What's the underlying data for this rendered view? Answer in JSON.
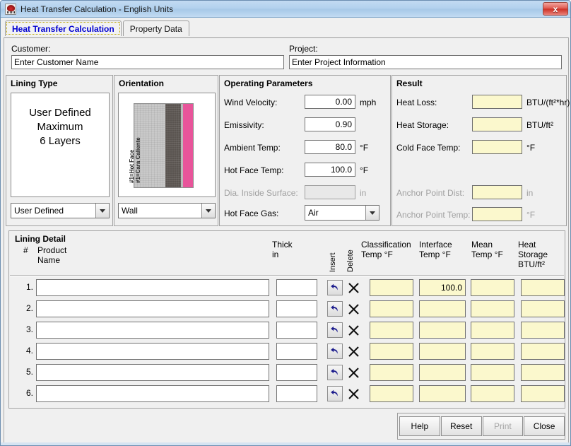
{
  "window": {
    "title": "Heat Transfer Calculation - English Units",
    "app_icon": "app-logo-icon",
    "close_label": "x"
  },
  "tabs": [
    {
      "label": "Heat Transfer Calculation",
      "active": true
    },
    {
      "label": "Property Data",
      "active": false
    }
  ],
  "header_fields": {
    "customer_label": "Customer:",
    "customer_value": "Enter Customer Name",
    "project_label": "Project:",
    "project_value": "Enter Project Information"
  },
  "lining_type": {
    "title": "Lining Type",
    "preview_line1": "User Defined",
    "preview_line2": "Maximum",
    "preview_line3": "6 Layers",
    "selected": "User Defined"
  },
  "orientation": {
    "title": "Orientation",
    "selected": "Wall",
    "diagram_caption_line1": "#1=Hot Face",
    "diagram_caption_line2": "#1=Cara Caliente",
    "band_hot_color": "#c9c9c9",
    "band_mid_color": "#5a5450",
    "band_cold_color": "#e8549a"
  },
  "operating_parameters": {
    "title": "Operating Parameters",
    "fields": [
      {
        "label": "Wind Velocity:",
        "value": "0.00",
        "unit": "mph",
        "disabled": false
      },
      {
        "label": "Emissivity:",
        "value": "0.90",
        "unit": "",
        "disabled": false
      },
      {
        "label": "Ambient Temp:",
        "value": "80.0",
        "unit": "°F",
        "disabled": false
      },
      {
        "label": "Hot Face Temp:",
        "value": "100.0",
        "unit": "°F",
        "disabled": false
      },
      {
        "label": "Dia. Inside Surface:",
        "value": "",
        "unit": "in",
        "disabled": true
      }
    ],
    "gas_label": "Hot Face Gas:",
    "gas_value": "Air"
  },
  "result": {
    "title": "Result",
    "fields": [
      {
        "label": "Heat Loss:",
        "value": "",
        "unit": "BTU/(ft²*hr)",
        "disabled": false
      },
      {
        "label": "Heat Storage:",
        "value": "",
        "unit": "BTU/ft²",
        "disabled": false
      },
      {
        "label": "Cold Face Temp:",
        "value": "",
        "unit": "°F",
        "disabled": false
      },
      {
        "label": "Anchor Point Dist:",
        "value": "",
        "unit": "in",
        "disabled": true
      },
      {
        "label": "Anchor Point Temp:",
        "value": "",
        "unit": "°F",
        "disabled": true
      }
    ]
  },
  "lining_detail": {
    "title": "Lining Detail",
    "columns": {
      "num": "#",
      "product_l1": "Product",
      "product_l2": "Name",
      "thick_l1": "Thick",
      "thick_l2": "in",
      "insert": "Insert",
      "delete": "Delete",
      "classification_l1": "Classification",
      "classification_l2": "Temp °F",
      "interface_l1": "Interface",
      "interface_l2": "Temp °F",
      "mean_l1": "Mean",
      "mean_l2": "Temp °F",
      "heatstorage_l1": "Heat Storage",
      "heatstorage_l2": "BTU/ft²"
    },
    "rows": [
      {
        "num": "1.",
        "product": "",
        "thick": "",
        "classification": "",
        "interface": "100.0",
        "mean": "",
        "heat_storage": ""
      },
      {
        "num": "2.",
        "product": "",
        "thick": "",
        "classification": "",
        "interface": "",
        "mean": "",
        "heat_storage": ""
      },
      {
        "num": "3.",
        "product": "",
        "thick": "",
        "classification": "",
        "interface": "",
        "mean": "",
        "heat_storage": ""
      },
      {
        "num": "4.",
        "product": "",
        "thick": "",
        "classification": "",
        "interface": "",
        "mean": "",
        "heat_storage": ""
      },
      {
        "num": "5.",
        "product": "",
        "thick": "",
        "classification": "",
        "interface": "",
        "mean": "",
        "heat_storage": ""
      },
      {
        "num": "6.",
        "product": "",
        "thick": "",
        "classification": "",
        "interface": "",
        "mean": "",
        "heat_storage": ""
      }
    ]
  },
  "buttons": [
    {
      "label": "Help",
      "disabled": false
    },
    {
      "label": "Reset",
      "disabled": false
    },
    {
      "label": "Print",
      "disabled": true
    },
    {
      "label": "Close",
      "disabled": false
    }
  ],
  "colors": {
    "result_field_bg": "#fbf8cd",
    "titlebar": "#b3d1ee",
    "active_tab_text": "#0000d0"
  }
}
